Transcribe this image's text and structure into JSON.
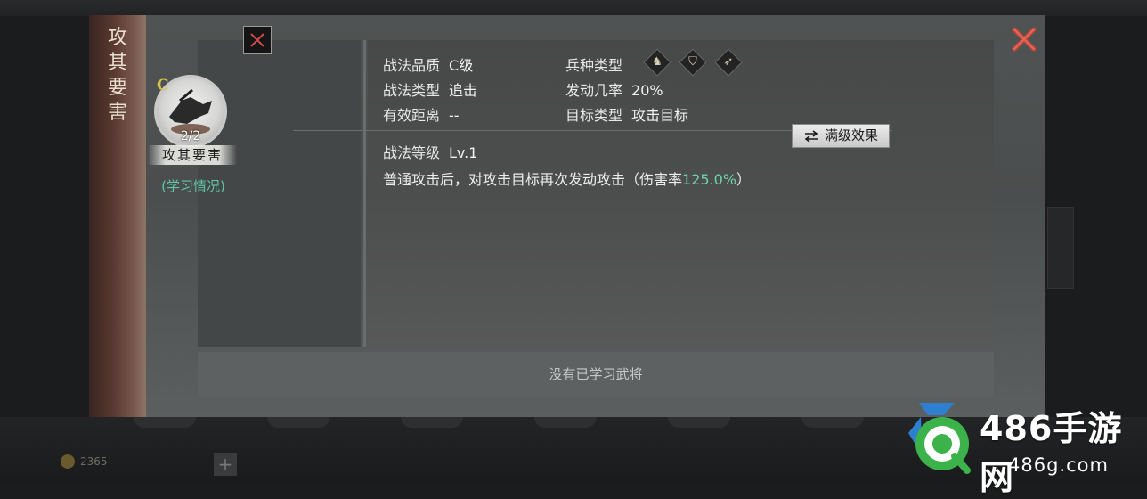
{
  "dialog": {
    "banner_title": "攻\n其\n要\n害"
  },
  "skill": {
    "grade_letter": "C",
    "count": "2/2",
    "name": "攻其要害",
    "learn_link": "(学习情况)"
  },
  "attributes": {
    "quality": {
      "label": "战法品质",
      "value": "C级"
    },
    "type": {
      "label": "战法类型",
      "value": "追击"
    },
    "range": {
      "label": "有效距离",
      "value": "--"
    },
    "troop_type": {
      "label": "兵种类型",
      "icons": [
        "cavalry-icon",
        "shield-icon",
        "bow-icon"
      ]
    },
    "trigger_rate": {
      "label": "发动几率",
      "value": "20%"
    },
    "target_type": {
      "label": "目标类型",
      "value": "攻击目标"
    },
    "level": {
      "label": "战法等级",
      "value": "Lv.1"
    }
  },
  "max_level_button": "满级效果",
  "description": {
    "prefix": "普通攻击后，对攻击目标再次发动攻击（伤害率",
    "highlight": "125.0%",
    "suffix": "）"
  },
  "bottom_text": "没有已学习武将",
  "background": {
    "gold_value": "2365"
  },
  "watermark": {
    "brand": "486手游网",
    "domain": "486g.com"
  },
  "colors": {
    "highlight": "#6fd2a9",
    "link": "#5fc7a6",
    "grade": "#d7c04a",
    "close": "#c8453a"
  }
}
